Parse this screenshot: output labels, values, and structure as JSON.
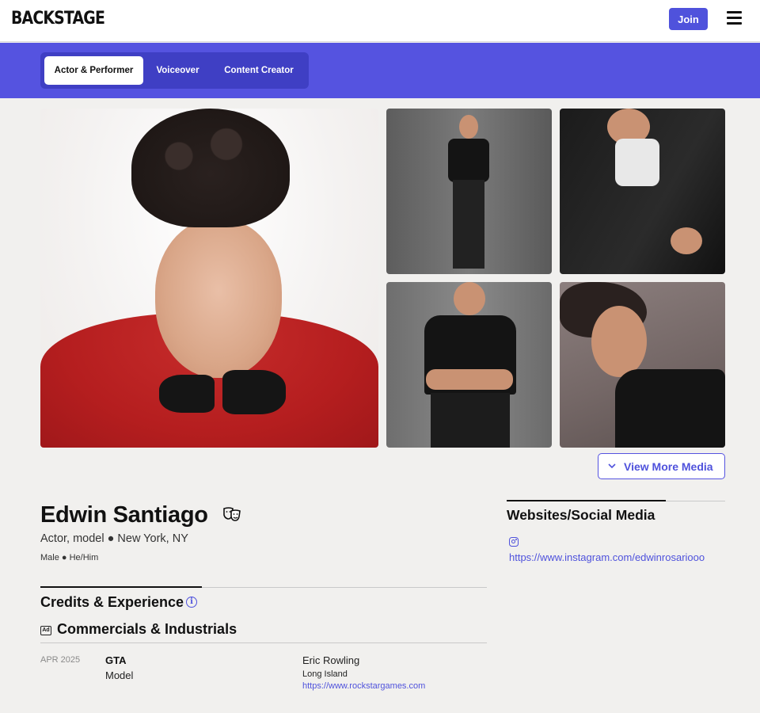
{
  "header": {
    "logo": "BACKSTAGE",
    "join_label": "Join",
    "menu_icon": "hamburger-menu-icon"
  },
  "tabs": [
    {
      "label": "Actor & Performer",
      "active": true
    },
    {
      "label": "Voiceover",
      "active": false
    },
    {
      "label": "Content Creator",
      "active": false
    }
  ],
  "media": {
    "view_more_label": "View More Media"
  },
  "profile": {
    "name": "Edwin Santiago",
    "subtitle": "Actor, model ● New York, NY",
    "details": "Male ● He/Him"
  },
  "credits": {
    "title": "Credits & Experience",
    "section": "Commercials & Industrials",
    "ad_badge": "Ad",
    "items": [
      {
        "date": "APR 2025",
        "title": "GTA",
        "role": "Model",
        "director": "Eric Rowling",
        "location": "Long Island",
        "link": "https://www.rockstargames.com"
      }
    ]
  },
  "websites": {
    "title": "Websites/Social Media",
    "links": [
      {
        "icon": "instagram-icon",
        "url": "https://www.instagram.com/edwinrosariooo"
      }
    ]
  },
  "colors": {
    "accent": "#5553e0",
    "button": "#4f52dc",
    "background": "#f1f0ee"
  }
}
